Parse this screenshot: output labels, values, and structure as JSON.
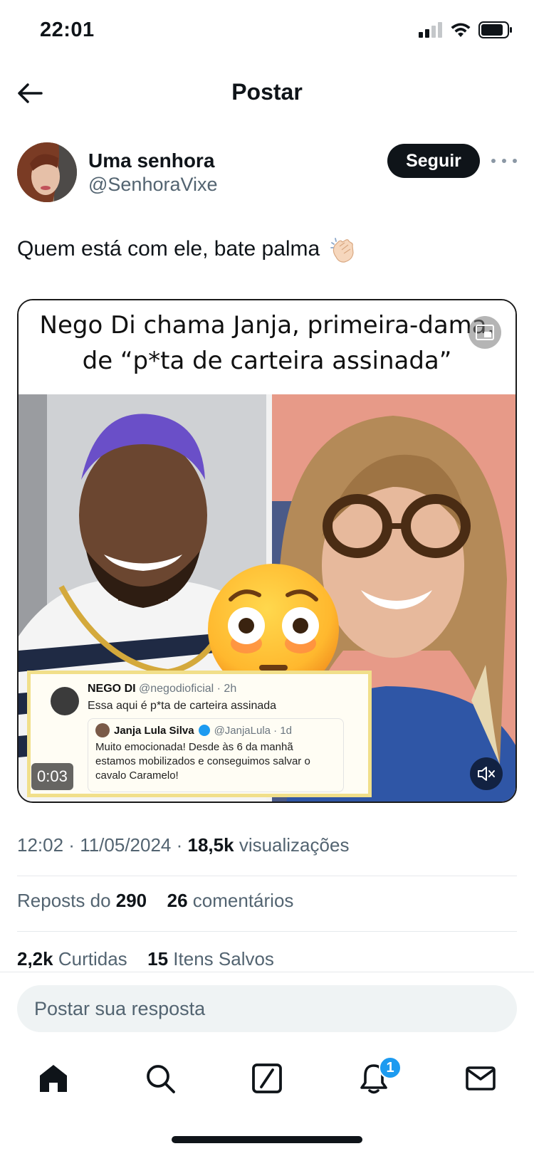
{
  "status_bar": {
    "time": "22:01"
  },
  "nav": {
    "title": "Postar"
  },
  "post": {
    "author_name": "Uma senhora",
    "author_handle": "@SenhoraVixe",
    "follow_label": "Seguir",
    "text": "Quem está com ele, bate palma",
    "media": {
      "headline_line1": "Nego Di chama Janja, primeira-dama,",
      "headline_line2": "de “p*ta de carteira assinada”",
      "video_time": "0:03",
      "quote": {
        "author": "NEGO DI",
        "handle": "@negodioficial · 2h",
        "text": "Essa aqui é p*ta de carteira assinada",
        "inner_author": "Janja Lula Silva",
        "inner_handle": "@JanjaLula · 1d",
        "inner_text": "Muito emocionada! Desde às 6 da manhã estamos mobilizados e conseguimos salvar o cavalo Caramelo!"
      }
    },
    "meta": {
      "time": "12:02",
      "date": "11/05/2024",
      "views": "18,5k",
      "views_label": "visualizações"
    },
    "stats": {
      "reposts_label": "Reposts do",
      "reposts": "290",
      "comments": "26",
      "comments_label": "comentários",
      "likes": "2,2k",
      "likes_label": "Curtidas",
      "saves": "15",
      "saves_label": "Itens Salvos"
    }
  },
  "reply": {
    "placeholder": "Postar sua resposta"
  },
  "tabs": [
    {
      "name": "home",
      "icon": "home-icon"
    },
    {
      "name": "search",
      "icon": "search-icon"
    },
    {
      "name": "grok",
      "icon": "grok-icon"
    },
    {
      "name": "notifications",
      "icon": "bell-icon",
      "badge": "1"
    },
    {
      "name": "messages",
      "icon": "mail-icon"
    }
  ],
  "colors": {
    "accent": "#1d9bf0",
    "text": "#0f1419",
    "secondary": "#536471",
    "follow_bg": "#0f1419"
  }
}
